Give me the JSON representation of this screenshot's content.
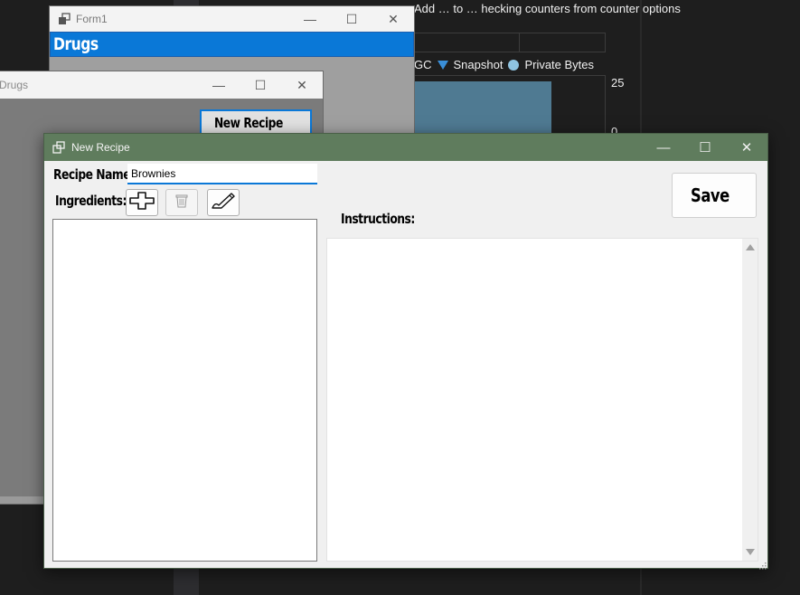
{
  "background": {
    "diagnostic_text": "Add … to … checking counters from counter options",
    "legend": {
      "gc_fragment": "GC",
      "snapshot": "Snapshot",
      "private_bytes": "Private Bytes"
    },
    "axis_top": "25",
    "axis_bottom": "0"
  },
  "form1": {
    "title": "Form1",
    "header": "Drugs"
  },
  "drugs_window": {
    "title": "Drugs",
    "new_recipe_button": "New Recipe"
  },
  "dialog": {
    "title": "New Recipe",
    "recipe_name_label": "Recipe Name:",
    "recipe_name_value": "Brownies",
    "ingredients_label": "Ingredients:",
    "instructions_label": "Instructions:",
    "save_label": "Save",
    "ingredients": [],
    "instructions_text": ""
  },
  "caption": {
    "minimize": "—",
    "maximize": "☐",
    "close": "✕"
  },
  "colors": {
    "dialog_titlebar": "#5f7c5d",
    "accent_blue": "#0a78d7",
    "chart_bar": "#4f7a92"
  },
  "icons": {
    "add": "plus-outline-icon",
    "delete": "trash-icon",
    "edit": "pencil-icon",
    "window": "window-icon"
  }
}
